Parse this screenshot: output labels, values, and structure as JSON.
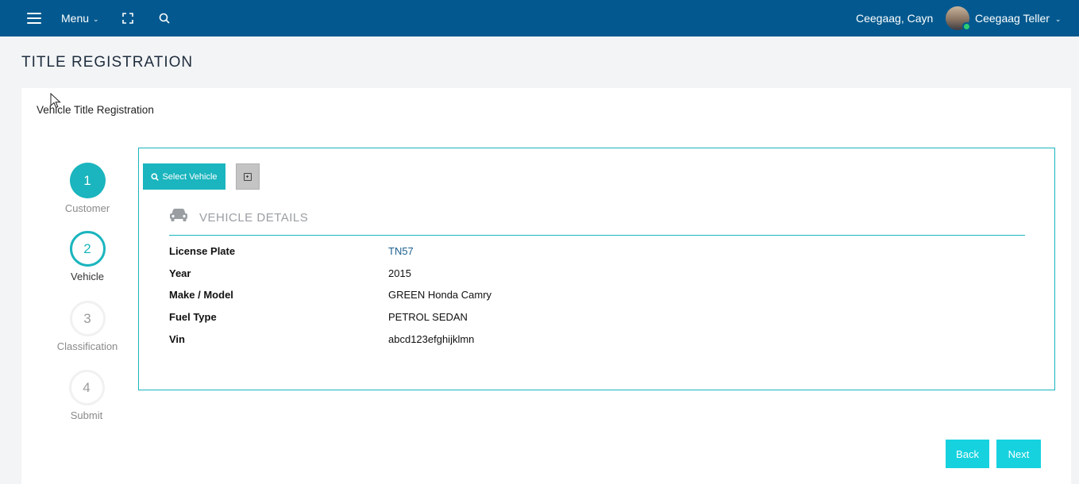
{
  "topbar": {
    "menu_label": "Menu",
    "user_name": "Ceegaag, Cayn",
    "role_label": "Ceegaag Teller"
  },
  "page": {
    "title": "TITLE REGISTRATION",
    "subtitle": "Vehicle Title Registration"
  },
  "steps": [
    {
      "number": "1",
      "label": "Customer",
      "state": "done"
    },
    {
      "number": "2",
      "label": "Vehicle",
      "state": "active"
    },
    {
      "number": "3",
      "label": "Classification",
      "state": "todo"
    },
    {
      "number": "4",
      "label": "Submit",
      "state": "todo"
    }
  ],
  "panel": {
    "select_vehicle_label": "Select Vehicle",
    "section_title": "VEHICLE DETAILS",
    "details": [
      {
        "key": "License Plate",
        "value": "TN57"
      },
      {
        "key": "Year",
        "value": "2015"
      },
      {
        "key": "Make / Model",
        "value": "GREEN Honda Camry"
      },
      {
        "key": "Fuel Type",
        "value": "PETROL SEDAN"
      },
      {
        "key": "Vin",
        "value": "abcd123efghijklmn"
      }
    ]
  },
  "actions": {
    "back_label": "Back",
    "next_label": "Next"
  },
  "colors": {
    "topbar": "#03598f",
    "accent": "#1ab5be",
    "nav_button": "#16d2df",
    "link": "#1b5f8f"
  }
}
